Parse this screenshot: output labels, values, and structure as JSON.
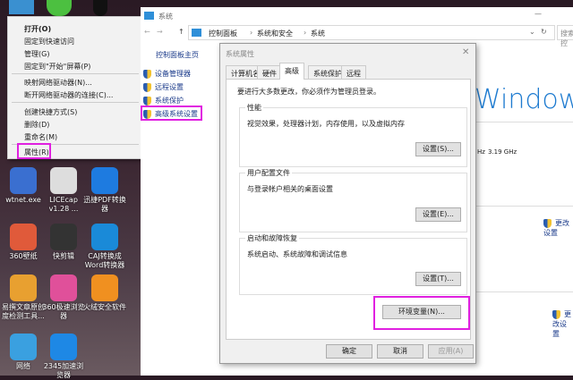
{
  "desktop": {
    "icons": [
      {
        "label": "wtnet.exe",
        "color": "#3a6fd0"
      },
      {
        "label": "LICEcap v1.28 ...",
        "color": "#dddddd"
      },
      {
        "label": "迅捷PDF转换器",
        "color": "#1e7be0"
      },
      {
        "label": "360壁纸",
        "color": "#e05a3a"
      },
      {
        "label": "快剪辑",
        "color": "#333333"
      },
      {
        "label": "CAJ转换成Word转换器",
        "color": "#1a8ad8"
      },
      {
        "label": "易撰文章原创度检测工具...",
        "color": "#e8a030"
      },
      {
        "label": "360极速浏览器",
        "color": "#e0509a"
      },
      {
        "label": "火绒安全软件",
        "color": "#f09020"
      },
      {
        "label": "网络",
        "color": "#3aa0e0"
      },
      {
        "label": "2345加速浏览器",
        "color": "#1e88e5"
      }
    ]
  },
  "context_menu": {
    "items": [
      "打开(O)",
      "固定到快速访问",
      "管理(G)",
      "固定到\"开始\"屏幕(P)",
      "映射网络驱动器(N)...",
      "断开网络驱动器的连接(C)...",
      "创建快捷方式(S)",
      "删除(D)",
      "重命名(M)",
      "属性(R)"
    ]
  },
  "explorer": {
    "title": "系统",
    "breadcrumb": [
      "控制面板",
      "系统和安全",
      "系统"
    ],
    "search_placeholder": "搜索控",
    "sidebar": {
      "home": "控制面板主页",
      "links": [
        "设备管理器",
        "远程设置",
        "系统保护",
        "高级系统设置"
      ]
    },
    "windows_text": "Windows",
    "cpu_speed_suffix": "Hz",
    "cpu_speed": "3.19 GHz",
    "change_settings": "更改设置"
  },
  "dialog": {
    "title": "系统属性",
    "tabs": [
      "计算机名",
      "硬件",
      "高级",
      "系统保护",
      "远程"
    ],
    "active_tab": "高级",
    "admin_note": "要进行大多数更改，你必须作为管理员登录。",
    "groups": [
      {
        "label": "性能",
        "desc": "视觉效果，处理器计划，内存使用，以及虚拟内存",
        "button": "设置(S)..."
      },
      {
        "label": "用户配置文件",
        "desc": "与登录帐户相关的桌面设置",
        "button": "设置(E)..."
      },
      {
        "label": "启动和故障恢复",
        "desc": "系统启动、系统故障和调试信息",
        "button": "设置(T)..."
      }
    ],
    "env_button": "环境变量(N)...",
    "ok": "确定",
    "cancel": "取消",
    "apply": "应用(A)"
  },
  "highlight_color": "#e020e0"
}
